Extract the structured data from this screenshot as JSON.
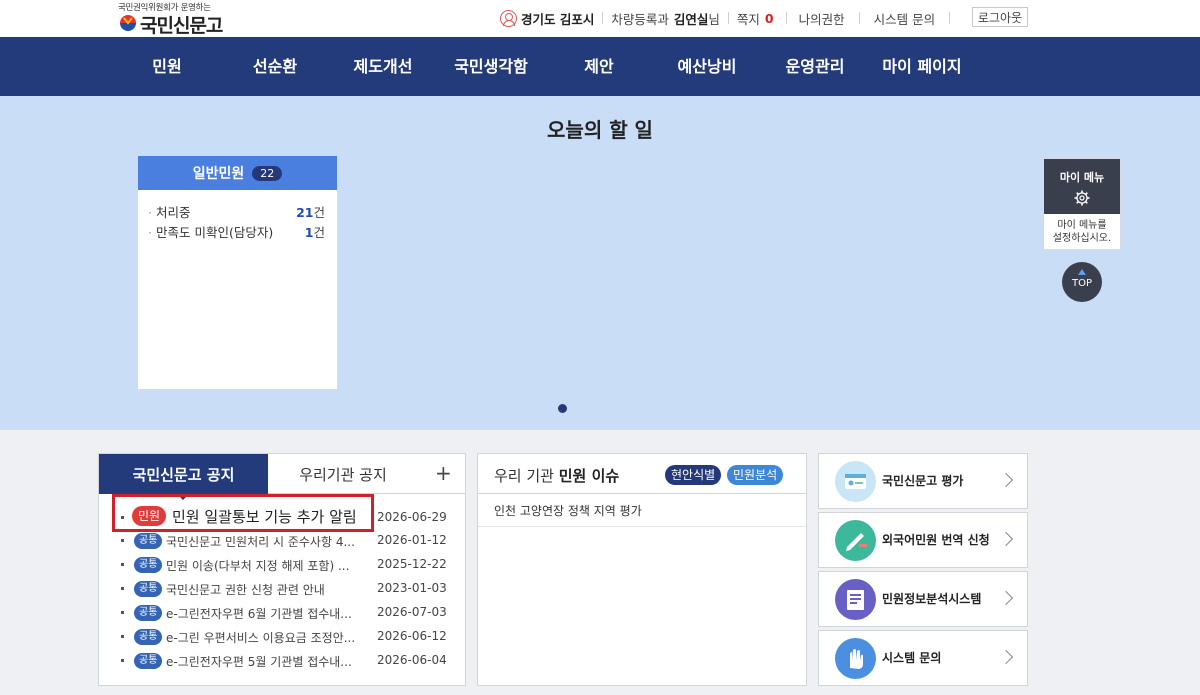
{
  "header": {
    "logo_sub": "국민권익위원회가 운영하는",
    "logo_main": "국민신문고",
    "user_region": "경기도 김포시",
    "user_dept": "차량등록과",
    "user_name": "김연실",
    "user_suffix": "님",
    "message_label": "쪽지",
    "message_count": "0",
    "my_rights": "나의권한",
    "system_inquiry": "시스템 문의",
    "logout": "로그아웃"
  },
  "nav": {
    "items": [
      {
        "label": "민원"
      },
      {
        "label": "선순환"
      },
      {
        "label": "제도개선"
      },
      {
        "label": "국민생각함"
      },
      {
        "label": "제안"
      },
      {
        "label": "예산낭비"
      },
      {
        "label": "운영관리"
      },
      {
        "label": "마이 페이지"
      }
    ]
  },
  "hero": {
    "title": "오늘의 할 일",
    "card": {
      "title": "일반민원",
      "badge": "22",
      "rows": [
        {
          "label": "처리중",
          "count": "21",
          "unit": "건"
        },
        {
          "label": "만족도 미확인(담당자)",
          "count": "1",
          "unit": "건"
        }
      ]
    }
  },
  "side": {
    "mymenu_title": "마이 메뉴",
    "mymenu_line1": "마이 메뉴를",
    "mymenu_line2": "설정하십시오.",
    "top_label": "TOP"
  },
  "notice": {
    "tab_active": "국민신문고 공지",
    "tab_inactive": "우리기관 공지",
    "plus": "+",
    "items": [
      {
        "cat": "민원",
        "title": "민원 일괄통보 기능 추가 알림",
        "date": "2026-06-29"
      },
      {
        "cat": "공통",
        "title": "국민신문고 민원처리 시 준수사항 4...",
        "date": "2026-01-12"
      },
      {
        "cat": "공통",
        "title": "민원 이송(다부처 지정 해제 포함) ...",
        "date": "2025-12-22"
      },
      {
        "cat": "공통",
        "title": "국민신문고 권한 신청 관련 안내",
        "date": "2023-01-03"
      },
      {
        "cat": "공통",
        "title": "e-그린전자우편 6월 기관별 접수내...",
        "date": "2026-07-03"
      },
      {
        "cat": "공통",
        "title": "e-그린 우편서비스 이용요금 조정안...",
        "date": "2026-06-12"
      },
      {
        "cat": "공통",
        "title": "e-그린전자우편 5월 기관별 접수내...",
        "date": "2026-06-04"
      }
    ]
  },
  "issue": {
    "title_prefix": "우리 기관",
    "title_bold": "민원 이슈",
    "pill1": "현안식별",
    "pill2": "민원분석",
    "item": "인천 고양연장 정책 지역 평가"
  },
  "quick": [
    {
      "label": "국민신문고 평가",
      "icon": "evaluation-icon",
      "color": "#8fd0ec"
    },
    {
      "label": "외국어민원 번역 신청",
      "icon": "translation-icon",
      "color": "#3cb89a"
    },
    {
      "label": "민원정보분석시스템",
      "icon": "analysis-icon",
      "color": "#6a5fc4"
    },
    {
      "label": "시스템 문의",
      "icon": "inquiry-icon",
      "color": "#4a8fe0"
    }
  ]
}
